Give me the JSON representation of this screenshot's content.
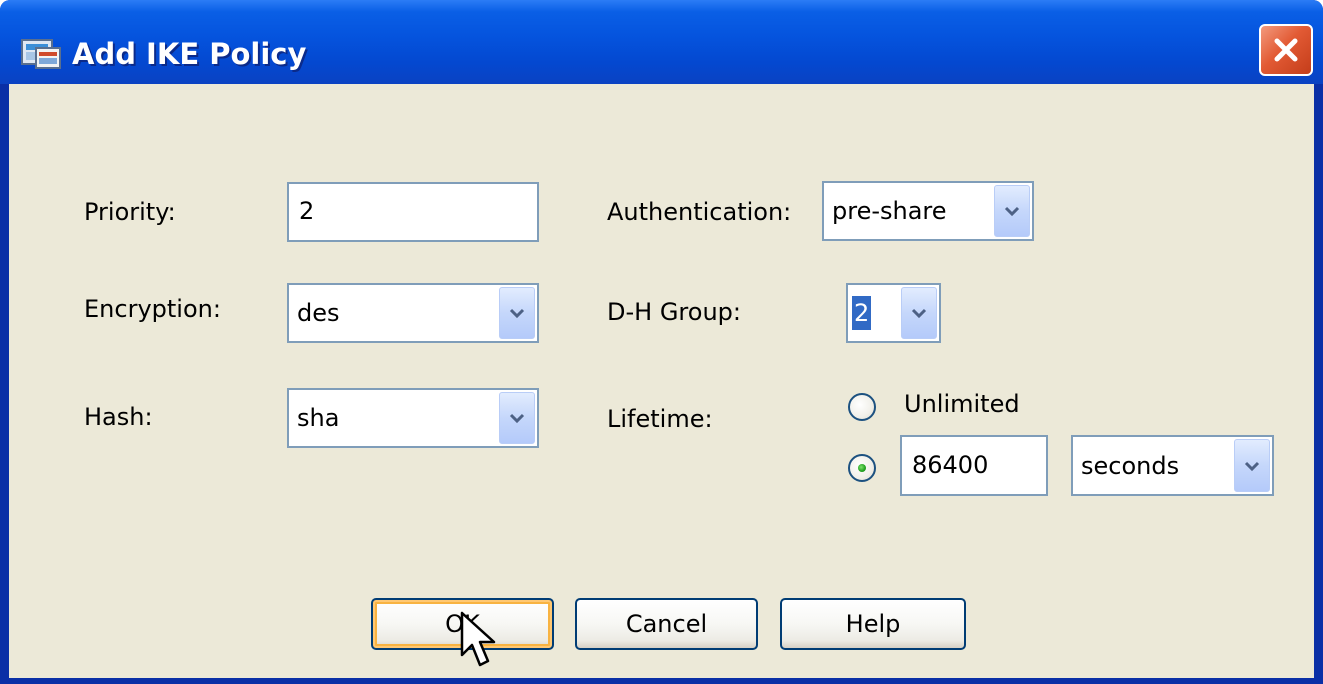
{
  "window": {
    "title": "Add IKE Policy",
    "icon": "asdm-app-icon",
    "close_icon": "close-icon"
  },
  "form": {
    "priority": {
      "label": "Priority:",
      "value": "2"
    },
    "encryption": {
      "label": "Encryption:",
      "value": "des"
    },
    "hash": {
      "label": "Hash:",
      "value": "sha"
    },
    "authentication": {
      "label": "Authentication:",
      "value": "pre-share"
    },
    "dh_group": {
      "label": "D-H Group:",
      "value": "2"
    },
    "lifetime": {
      "label": "Lifetime:",
      "unlimited_label": "Unlimited",
      "unlimited_selected": false,
      "custom_selected": true,
      "value": "86400",
      "unit": "seconds"
    }
  },
  "buttons": {
    "ok": "OK",
    "cancel": "Cancel",
    "help": "Help"
  },
  "colors": {
    "titlebar": "#0553dd",
    "client_bg": "#ece9d8",
    "close_btn": "#e25a34",
    "selection": "#316ac5"
  }
}
